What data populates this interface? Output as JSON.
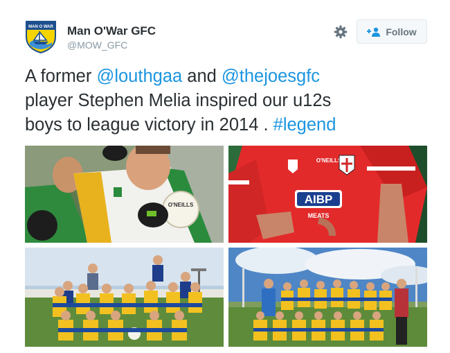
{
  "account": {
    "display_name": "Man O'War GFC",
    "handle": "@MOW_GFC",
    "avatar_icon": "club-crest-icon",
    "avatar_crest_text": "MAN O WAR"
  },
  "actions": {
    "settings_icon": "gear-icon",
    "follow_icon": "add-user-icon",
    "follow_label": "Follow"
  },
  "tweet": {
    "line1_prefix": "A former ",
    "mention1": "@louthgaa",
    "line1_mid": " and ",
    "mention2": "@thejoesgfc",
    "line2": "player Stephen Melia inspired our u12s",
    "line3_prefix": "boys to league victory in 2014 . ",
    "hashtag": "#legend"
  },
  "photos": {
    "photo2_jersey_brand": "O'NEILLS",
    "photo2_sponsor": "AIBP",
    "photo2_sponsor_sub": "MEATS",
    "photo1_ball_text": "O'NEILLS"
  },
  "colors": {
    "text": "#292f33",
    "link": "#1b95e0",
    "muted": "#8899a6",
    "button_bg": "#f5f8fa",
    "button_border": "#e1e8ed"
  }
}
